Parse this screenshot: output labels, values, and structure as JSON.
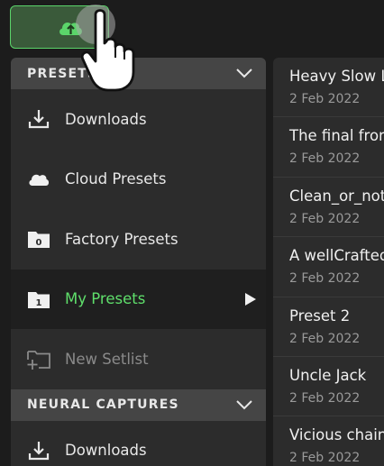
{
  "toolbar": {
    "cloud_button_icon": "cloud-upload-icon",
    "accent": "#5bd46a"
  },
  "menu": {
    "presets_header": "PRESETS",
    "items": [
      {
        "label": "Downloads",
        "icon": "download-icon"
      },
      {
        "label": "Cloud Presets",
        "icon": "cloud-icon"
      },
      {
        "label": "Factory Presets",
        "icon": "folder-0-icon",
        "badge": "0"
      },
      {
        "label": "My Presets",
        "icon": "folder-1-icon",
        "badge": "1",
        "selected": true
      },
      {
        "label": "New Setlist",
        "icon": "new-folder-icon",
        "disabled": true
      }
    ],
    "neural_header": "NEURAL CAPTURES",
    "neural_items": [
      {
        "label": "Downloads",
        "icon": "download-icon"
      }
    ]
  },
  "presets": [
    {
      "name": "Heavy Slow Lead",
      "date": "2 Feb 2022"
    },
    {
      "name": "The final frontier",
      "date": "2 Feb 2022"
    },
    {
      "name": "Clean_or_not",
      "date": "2 Feb 2022"
    },
    {
      "name": "A wellCrafted tone",
      "date": "2 Feb 2022"
    },
    {
      "name": "Preset 2",
      "date": "2 Feb 2022"
    },
    {
      "name": "Uncle Jack",
      "date": "2 Feb 2022"
    },
    {
      "name": "Vicious chain",
      "date": "2 Feb 2022"
    }
  ]
}
